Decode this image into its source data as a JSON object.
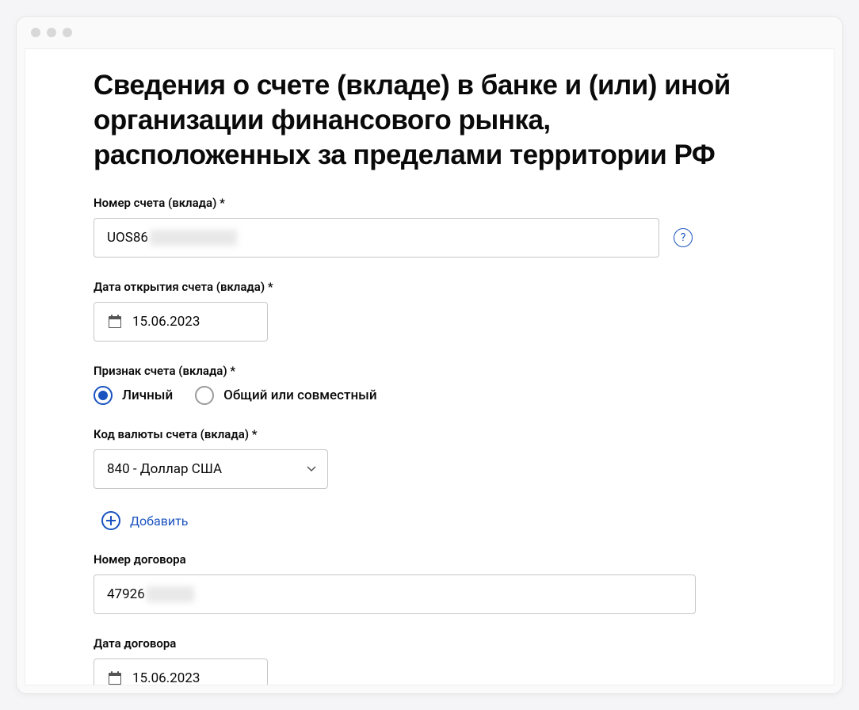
{
  "page": {
    "title": "Сведения о счете (вкладе) в банке и (или) иной организации финансового рынка, расположенных за пределами территории РФ"
  },
  "account_number": {
    "label": "Номер счета (вклада) *",
    "value_visible": "UOS86"
  },
  "open_date": {
    "label": "Дата открытия счета (вклада) *",
    "value": "15.06.2023"
  },
  "account_type": {
    "label": "Признак счета (вклада) *",
    "options": {
      "personal": "Личный",
      "joint": "Общий или совместный"
    },
    "selected": "personal"
  },
  "currency": {
    "label": "Код валюты счета (вклада) *",
    "value": "840 - Доллар США"
  },
  "add_action": {
    "label": "Добавить"
  },
  "contract_number": {
    "label": "Номер договора",
    "value_visible": "47926"
  },
  "contract_date": {
    "label": "Дата договора",
    "value": "15.06.2023"
  },
  "help_tooltip": "?"
}
